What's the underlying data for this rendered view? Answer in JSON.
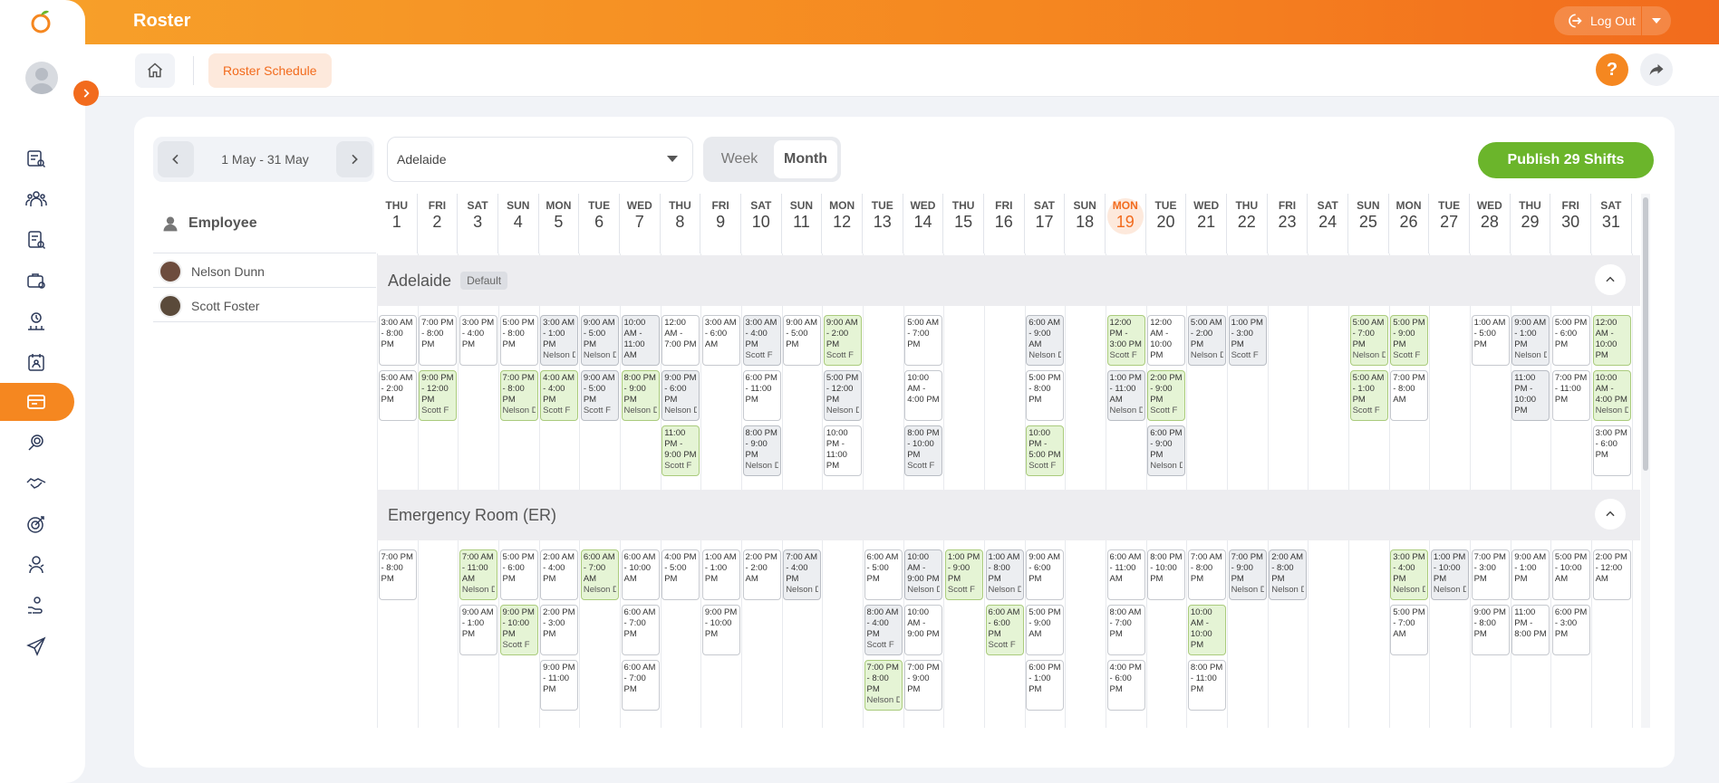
{
  "app": {
    "title": "Roster"
  },
  "header": {
    "logout_label": "Log Out"
  },
  "breadcrumb": {
    "label": "Roster Schedule"
  },
  "help": {
    "label": "?"
  },
  "toolbar": {
    "date_range": "1 May - 31 May",
    "location": "Adelaide",
    "view_week": "Week",
    "view_month": "Month",
    "publish_label": "Publish 29 Shifts"
  },
  "employees": {
    "header": "Employee",
    "rows": [
      "Nelson Dunn",
      "Scott Foster"
    ]
  },
  "days": [
    {
      "name": "THU",
      "num": "1"
    },
    {
      "name": "FRI",
      "num": "2"
    },
    {
      "name": "SAT",
      "num": "3"
    },
    {
      "name": "SUN",
      "num": "4"
    },
    {
      "name": "MON",
      "num": "5"
    },
    {
      "name": "TUE",
      "num": "6"
    },
    {
      "name": "WED",
      "num": "7"
    },
    {
      "name": "THU",
      "num": "8"
    },
    {
      "name": "FRI",
      "num": "9"
    },
    {
      "name": "SAT",
      "num": "10"
    },
    {
      "name": "SUN",
      "num": "11"
    },
    {
      "name": "MON",
      "num": "12"
    },
    {
      "name": "TUE",
      "num": "13"
    },
    {
      "name": "WED",
      "num": "14"
    },
    {
      "name": "THU",
      "num": "15"
    },
    {
      "name": "FRI",
      "num": "16"
    },
    {
      "name": "SAT",
      "num": "17"
    },
    {
      "name": "SUN",
      "num": "18"
    },
    {
      "name": "MON",
      "num": "19"
    },
    {
      "name": "TUE",
      "num": "20"
    },
    {
      "name": "WED",
      "num": "21"
    },
    {
      "name": "THU",
      "num": "22"
    },
    {
      "name": "FRI",
      "num": "23"
    },
    {
      "name": "SAT",
      "num": "24"
    },
    {
      "name": "SUN",
      "num": "25"
    },
    {
      "name": "MON",
      "num": "26"
    },
    {
      "name": "TUE",
      "num": "27"
    },
    {
      "name": "WED",
      "num": "28"
    },
    {
      "name": "THU",
      "num": "29"
    },
    {
      "name": "FRI",
      "num": "30"
    },
    {
      "name": "SAT",
      "num": "31"
    }
  ],
  "today_index": 18,
  "groups": [
    {
      "name": "Adelaide",
      "badge": "Default",
      "shifts": [
        {
          "d": 0,
          "r": 0,
          "t": "3:00 AM - 8:00 PM",
          "w": "",
          "c": "white"
        },
        {
          "d": 1,
          "r": 0,
          "t": "7:00 PM - 8:00 PM",
          "w": "",
          "c": "white"
        },
        {
          "d": 2,
          "r": 0,
          "t": "3:00 PM - 4:00 PM",
          "w": "",
          "c": "white"
        },
        {
          "d": 3,
          "r": 0,
          "t": "5:00 PM - 8:00 PM",
          "w": "",
          "c": "white"
        },
        {
          "d": 4,
          "r": 0,
          "t": "3:00 AM - 1:00 PM",
          "w": "Nelson D",
          "c": "gray"
        },
        {
          "d": 5,
          "r": 0,
          "t": "9:00 AM - 5:00 PM",
          "w": "Nelson D",
          "c": "gray"
        },
        {
          "d": 6,
          "r": 0,
          "t": "10:00 AM - 11:00 AM",
          "w": "",
          "c": "gray"
        },
        {
          "d": 7,
          "r": 0,
          "t": "12:00 AM - 7:00 PM",
          "w": "",
          "c": "white"
        },
        {
          "d": 8,
          "r": 0,
          "t": "3:00 AM - 6:00 AM",
          "w": "",
          "c": "white"
        },
        {
          "d": 9,
          "r": 0,
          "t": "3:00 AM - 4:00 PM",
          "w": "Scott F",
          "c": "gray"
        },
        {
          "d": 10,
          "r": 0,
          "t": "9:00 AM - 5:00 PM",
          "w": "",
          "c": "white"
        },
        {
          "d": 11,
          "r": 0,
          "t": "9:00 AM - 2:00 PM",
          "w": "Scott F",
          "c": "green"
        },
        {
          "d": 13,
          "r": 0,
          "t": "5:00 AM - 7:00 PM",
          "w": "",
          "c": "white"
        },
        {
          "d": 16,
          "r": 0,
          "t": "6:00 AM - 9:00 AM",
          "w": "Nelson D",
          "c": "gray"
        },
        {
          "d": 18,
          "r": 0,
          "t": "12:00 PM - 3:00 PM",
          "w": "Scott F",
          "c": "green"
        },
        {
          "d": 19,
          "r": 0,
          "t": "12:00 AM - 10:00 PM",
          "w": "",
          "c": "white"
        },
        {
          "d": 20,
          "r": 0,
          "t": "5:00 AM - 2:00 PM",
          "w": "Nelson D",
          "c": "gray"
        },
        {
          "d": 21,
          "r": 0,
          "t": "1:00 PM - 3:00 PM",
          "w": "Scott F",
          "c": "gray"
        },
        {
          "d": 24,
          "r": 0,
          "t": "5:00 AM - 7:00 PM",
          "w": "Nelson D",
          "c": "green"
        },
        {
          "d": 25,
          "r": 0,
          "t": "5:00 PM - 9:00 PM",
          "w": "Scott F",
          "c": "green"
        },
        {
          "d": 27,
          "r": 0,
          "t": "1:00 AM - 5:00 PM",
          "w": "",
          "c": "white"
        },
        {
          "d": 28,
          "r": 0,
          "t": "9:00 AM - 1:00 PM",
          "w": "Nelson D",
          "c": "gray"
        },
        {
          "d": 29,
          "r": 0,
          "t": "5:00 PM - 6:00 PM",
          "w": "",
          "c": "white"
        },
        {
          "d": 30,
          "r": 0,
          "t": "12:00 AM - 10:00 PM",
          "w": "",
          "c": "green"
        },
        {
          "d": 0,
          "r": 1,
          "t": "5:00 AM - 2:00 PM",
          "w": "",
          "c": "white"
        },
        {
          "d": 1,
          "r": 1,
          "t": "9:00 PM - 12:00 PM",
          "w": "Scott F",
          "c": "green"
        },
        {
          "d": 3,
          "r": 1,
          "t": "7:00 PM - 8:00 PM",
          "w": "Nelson D",
          "c": "green"
        },
        {
          "d": 4,
          "r": 1,
          "t": "4:00 AM - 4:00 PM",
          "w": "Scott F",
          "c": "green"
        },
        {
          "d": 5,
          "r": 1,
          "t": "9:00 AM - 5:00 PM",
          "w": "Scott F",
          "c": "gray"
        },
        {
          "d": 6,
          "r": 1,
          "t": "8:00 PM - 9:00 PM",
          "w": "Nelson D",
          "c": "green"
        },
        {
          "d": 7,
          "r": 1,
          "t": "9:00 PM - 6:00 PM",
          "w": "Nelson D",
          "c": "gray"
        },
        {
          "d": 9,
          "r": 1,
          "t": "6:00 PM - 11:00 PM",
          "w": "",
          "c": "white"
        },
        {
          "d": 11,
          "r": 1,
          "t": "5:00 PM - 12:00 PM",
          "w": "Nelson D",
          "c": "gray"
        },
        {
          "d": 13,
          "r": 1,
          "t": "10:00 AM - 4:00 PM",
          "w": "",
          "c": "white"
        },
        {
          "d": 16,
          "r": 1,
          "t": "5:00 PM - 8:00 PM",
          "w": "",
          "c": "white"
        },
        {
          "d": 18,
          "r": 1,
          "t": "1:00 PM - 11:00 AM",
          "w": "Nelson D",
          "c": "gray"
        },
        {
          "d": 19,
          "r": 1,
          "t": "2:00 PM - 9:00 PM",
          "w": "Scott F",
          "c": "green"
        },
        {
          "d": 24,
          "r": 1,
          "t": "5:00 AM - 1:00 PM",
          "w": "Scott F",
          "c": "green"
        },
        {
          "d": 25,
          "r": 1,
          "t": "7:00 PM - 8:00 AM",
          "w": "",
          "c": "white"
        },
        {
          "d": 28,
          "r": 1,
          "t": "11:00 PM - 10:00 PM",
          "w": "",
          "c": "gray"
        },
        {
          "d": 29,
          "r": 1,
          "t": "7:00 PM - 11:00 PM",
          "w": "",
          "c": "white"
        },
        {
          "d": 30,
          "r": 1,
          "t": "10:00 AM - 4:00 PM",
          "w": "Nelson D",
          "c": "green"
        },
        {
          "d": 7,
          "r": 2,
          "t": "11:00 PM - 9:00 PM",
          "w": "Scott F",
          "c": "green"
        },
        {
          "d": 9,
          "r": 2,
          "t": "8:00 PM - 9:00 PM",
          "w": "Nelson D",
          "c": "gray"
        },
        {
          "d": 11,
          "r": 2,
          "t": "10:00 PM - 11:00 PM",
          "w": "",
          "c": "white"
        },
        {
          "d": 13,
          "r": 2,
          "t": "8:00 PM - 10:00 PM",
          "w": "Scott F",
          "c": "gray"
        },
        {
          "d": 16,
          "r": 2,
          "t": "10:00 PM - 5:00 PM",
          "w": "Scott F",
          "c": "green"
        },
        {
          "d": 19,
          "r": 2,
          "t": "6:00 PM - 9:00 PM",
          "w": "Nelson D",
          "c": "gray"
        },
        {
          "d": 30,
          "r": 2,
          "t": "3:00 PM - 6:00 PM",
          "w": "",
          "c": "white"
        }
      ]
    },
    {
      "name": "Emergency Room (ER)",
      "badge": "",
      "shifts": [
        {
          "d": 0,
          "r": 0,
          "t": "7:00 PM - 8:00 PM",
          "w": "",
          "c": "white"
        },
        {
          "d": 2,
          "r": 0,
          "t": "7:00 AM - 11:00 AM",
          "w": "Nelson D",
          "c": "green"
        },
        {
          "d": 3,
          "r": 0,
          "t": "5:00 PM - 6:00 PM",
          "w": "",
          "c": "white"
        },
        {
          "d": 4,
          "r": 0,
          "t": "2:00 AM - 4:00 PM",
          "w": "",
          "c": "white"
        },
        {
          "d": 5,
          "r": 0,
          "t": "6:00 AM - 7:00 AM",
          "w": "Nelson D",
          "c": "green"
        },
        {
          "d": 6,
          "r": 0,
          "t": "6:00 AM - 10:00 AM",
          "w": "",
          "c": "white"
        },
        {
          "d": 7,
          "r": 0,
          "t": "4:00 PM - 5:00 PM",
          "w": "",
          "c": "white"
        },
        {
          "d": 8,
          "r": 0,
          "t": "1:00 AM - 1:00 PM",
          "w": "",
          "c": "white"
        },
        {
          "d": 9,
          "r": 0,
          "t": "2:00 PM - 2:00 AM",
          "w": "",
          "c": "white"
        },
        {
          "d": 10,
          "r": 0,
          "t": "7:00 AM - 4:00 PM",
          "w": "Nelson D",
          "c": "gray"
        },
        {
          "d": 12,
          "r": 0,
          "t": "6:00 AM - 5:00 PM",
          "w": "",
          "c": "white"
        },
        {
          "d": 13,
          "r": 0,
          "t": "10:00 AM - 9:00 PM",
          "w": "Nelson D",
          "c": "gray"
        },
        {
          "d": 14,
          "r": 0,
          "t": "1:00 PM - 9:00 PM",
          "w": "Scott F",
          "c": "green"
        },
        {
          "d": 15,
          "r": 0,
          "t": "1:00 AM - 8:00 PM",
          "w": "Nelson D",
          "c": "gray"
        },
        {
          "d": 16,
          "r": 0,
          "t": "9:00 AM - 6:00 PM",
          "w": "",
          "c": "white"
        },
        {
          "d": 18,
          "r": 0,
          "t": "6:00 AM - 11:00 AM",
          "w": "",
          "c": "white"
        },
        {
          "d": 19,
          "r": 0,
          "t": "8:00 PM - 10:00 PM",
          "w": "",
          "c": "white"
        },
        {
          "d": 20,
          "r": 0,
          "t": "7:00 AM - 8:00 PM",
          "w": "",
          "c": "white"
        },
        {
          "d": 21,
          "r": 0,
          "t": "7:00 PM - 9:00 PM",
          "w": "Nelson D",
          "c": "gray"
        },
        {
          "d": 22,
          "r": 0,
          "t": "2:00 AM - 8:00 PM",
          "w": "Nelson D",
          "c": "gray"
        },
        {
          "d": 25,
          "r": 0,
          "t": "3:00 PM - 4:00 PM",
          "w": "Nelson D",
          "c": "green"
        },
        {
          "d": 26,
          "r": 0,
          "t": "1:00 PM - 10:00 PM",
          "w": "Nelson D",
          "c": "gray"
        },
        {
          "d": 27,
          "r": 0,
          "t": "7:00 PM - 3:00 PM",
          "w": "",
          "c": "white"
        },
        {
          "d": 28,
          "r": 0,
          "t": "9:00 AM - 1:00 PM",
          "w": "",
          "c": "white"
        },
        {
          "d": 29,
          "r": 0,
          "t": "5:00 PM - 10:00 AM",
          "w": "",
          "c": "white"
        },
        {
          "d": 30,
          "r": 0,
          "t": "2:00 PM - 12:00 AM",
          "w": "",
          "c": "white"
        },
        {
          "d": 2,
          "r": 1,
          "t": "9:00 AM - 1:00 PM",
          "w": "",
          "c": "white"
        },
        {
          "d": 3,
          "r": 1,
          "t": "9:00 PM - 10:00 PM",
          "w": "Scott F",
          "c": "green"
        },
        {
          "d": 4,
          "r": 1,
          "t": "2:00 PM - 3:00 PM",
          "w": "",
          "c": "white"
        },
        {
          "d": 6,
          "r": 1,
          "t": "6:00 AM - 7:00 PM",
          "w": "",
          "c": "white"
        },
        {
          "d": 8,
          "r": 1,
          "t": "9:00 PM - 10:00 PM",
          "w": "",
          "c": "white"
        },
        {
          "d": 12,
          "r": 1,
          "t": "8:00 AM - 4:00 PM",
          "w": "Scott F",
          "c": "gray"
        },
        {
          "d": 13,
          "r": 1,
          "t": "10:00 AM - 9:00 PM",
          "w": "",
          "c": "white"
        },
        {
          "d": 15,
          "r": 1,
          "t": "6:00 AM - 6:00 PM",
          "w": "Scott F",
          "c": "green"
        },
        {
          "d": 16,
          "r": 1,
          "t": "5:00 PM - 9:00 AM",
          "w": "",
          "c": "white"
        },
        {
          "d": 18,
          "r": 1,
          "t": "8:00 AM - 7:00 PM",
          "w": "",
          "c": "white"
        },
        {
          "d": 20,
          "r": 1,
          "t": "10:00 AM - 10:00 PM",
          "w": "",
          "c": "green"
        },
        {
          "d": 25,
          "r": 1,
          "t": "5:00 PM - 7:00 AM",
          "w": "",
          "c": "white"
        },
        {
          "d": 27,
          "r": 1,
          "t": "9:00 PM - 8:00 PM",
          "w": "",
          "c": "white"
        },
        {
          "d": 28,
          "r": 1,
          "t": "11:00 PM - 8:00 PM",
          "w": "",
          "c": "white"
        },
        {
          "d": 29,
          "r": 1,
          "t": "6:00 PM - 3:00 PM",
          "w": "",
          "c": "white"
        },
        {
          "d": 4,
          "r": 2,
          "t": "9:00 PM - 11:00 PM",
          "w": "",
          "c": "white"
        },
        {
          "d": 6,
          "r": 2,
          "t": "6:00 AM - 7:00 PM",
          "w": "",
          "c": "white"
        },
        {
          "d": 12,
          "r": 2,
          "t": "7:00 PM - 8:00 PM",
          "w": "Nelson D",
          "c": "green"
        },
        {
          "d": 13,
          "r": 2,
          "t": "7:00 PM - 9:00 PM",
          "w": "",
          "c": "white"
        },
        {
          "d": 16,
          "r": 2,
          "t": "6:00 PM - 1:00 PM",
          "w": "",
          "c": "white"
        },
        {
          "d": 18,
          "r": 2,
          "t": "4:00 PM - 6:00 PM",
          "w": "",
          "c": "white"
        },
        {
          "d": 20,
          "r": 2,
          "t": "8:00 PM - 11:00 PM",
          "w": "",
          "c": "white"
        }
      ]
    }
  ],
  "colors": {
    "accent": "#f26b1d",
    "publish": "#6bb52b",
    "shift_green": "#e5f4d5",
    "shift_gray": "#eceef1"
  }
}
